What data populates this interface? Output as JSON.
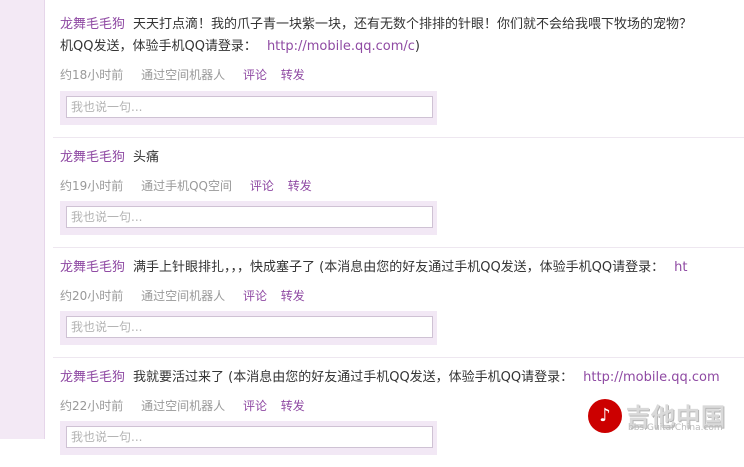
{
  "posts": [
    {
      "author": "龙舞毛毛狗",
      "text": "天天打点滴！我的爪子青一块紫一块，还有无数个排排的针眼！你们就不会给我喂下牧场的宠物？",
      "continuation": "机QQ发送，体验手机QQ请登录：",
      "link": "http://mobile.qq.com/c",
      "link_suffix": ")",
      "time": "约18小时前",
      "via": "通过空间机器人",
      "comment": "评论",
      "forward": "转发",
      "reply_placeholder": "我也说一句..."
    },
    {
      "author": "龙舞毛毛狗",
      "text": "头痛",
      "time": "约19小时前",
      "via": "通过手机QQ空间",
      "comment": "评论",
      "forward": "转发",
      "reply_placeholder": "我也说一句..."
    },
    {
      "author": "龙舞毛毛狗",
      "text": "满手上针眼排扎，，，快成塞子了 (本消息由您的好友通过手机QQ发送，体验手机QQ请登录：",
      "link": "ht",
      "time": "约20小时前",
      "via": "通过空间机器人",
      "comment": "评论",
      "forward": "转发",
      "reply_placeholder": "我也说一句..."
    },
    {
      "author": "龙舞毛毛狗",
      "text": "我就要活过来了 (本消息由您的好友通过手机QQ发送，体验手机QQ请登录：",
      "link": "http://mobile.qq.com",
      "time": "约22小时前",
      "via": "通过空间机器人",
      "comment": "评论",
      "forward": "转发",
      "reply_placeholder": "我也说一句..."
    }
  ],
  "watermark": {
    "title": "吉他中国",
    "url": "bbs.GuitarChina.com"
  }
}
